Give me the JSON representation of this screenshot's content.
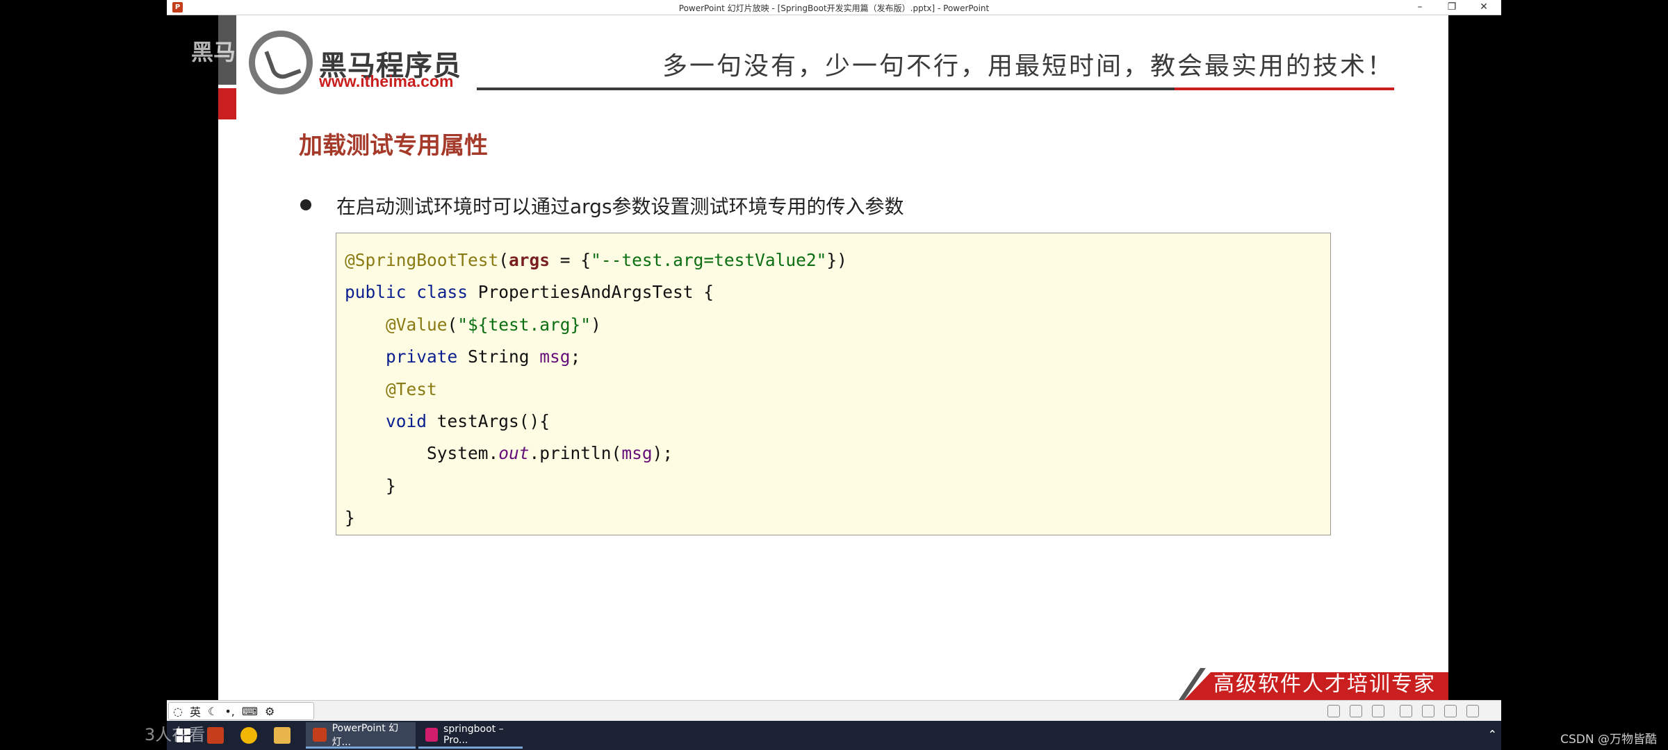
{
  "window": {
    "title": "PowerPoint 幻灯片放映 - [SpringBoot开发实用篇（发布版）.pptx] - PowerPoint",
    "app_icon": "P",
    "minimize": "–",
    "restore": "❐",
    "close": "✕"
  },
  "slide": {
    "logo_name": "黑马程序员",
    "logo_url": "www.itheima.com",
    "watermark": "黑马",
    "slogan": "多一句没有，少一句不行，用最短时间，教会最实用的技术！",
    "title": "加载测试专用属性",
    "bullet": "在启动测试环境时可以通过args参数设置测试环境专用的传入参数",
    "banner": "高级软件人才培训专家"
  },
  "code": {
    "l1_ann": "@SpringBootTest",
    "l1_p1": "(",
    "l1_param": "args",
    "l1_p2": " = {",
    "l1_str": "\"--test.arg=testValue2\"",
    "l1_p3": "})",
    "l2_kw": "public class",
    "l2_rest": " PropertiesAndArgsTest {",
    "l3_ind": "    ",
    "l3_ann": "@Value",
    "l3_p1": "(",
    "l3_str": "\"${test.arg}\"",
    "l3_p2": ")",
    "l4_ind": "    ",
    "l4_kw": "private",
    "l4_rest": " String ",
    "l4_field": "msg",
    "l4_end": ";",
    "l5_ind": "    ",
    "l5_ann": "@Test",
    "l6_ind": "    ",
    "l6_kw": "void",
    "l6_rest": " testArgs(){",
    "l7_ind": "        ",
    "l7_a": "System.",
    "l7_static": "out",
    "l7_b": ".println(",
    "l7_field": "msg",
    "l7_c": ");",
    "l8": "    }",
    "l9": "}"
  },
  "toolbar": {
    "ime_label": "英"
  },
  "taskbar": {
    "ppt_label": "PowerPoint 幻灯...",
    "idea_label": "springboot – Pro..."
  },
  "overlay": {
    "live_text": "3人在看",
    "csdn": "CSDN @万物皆酷"
  }
}
